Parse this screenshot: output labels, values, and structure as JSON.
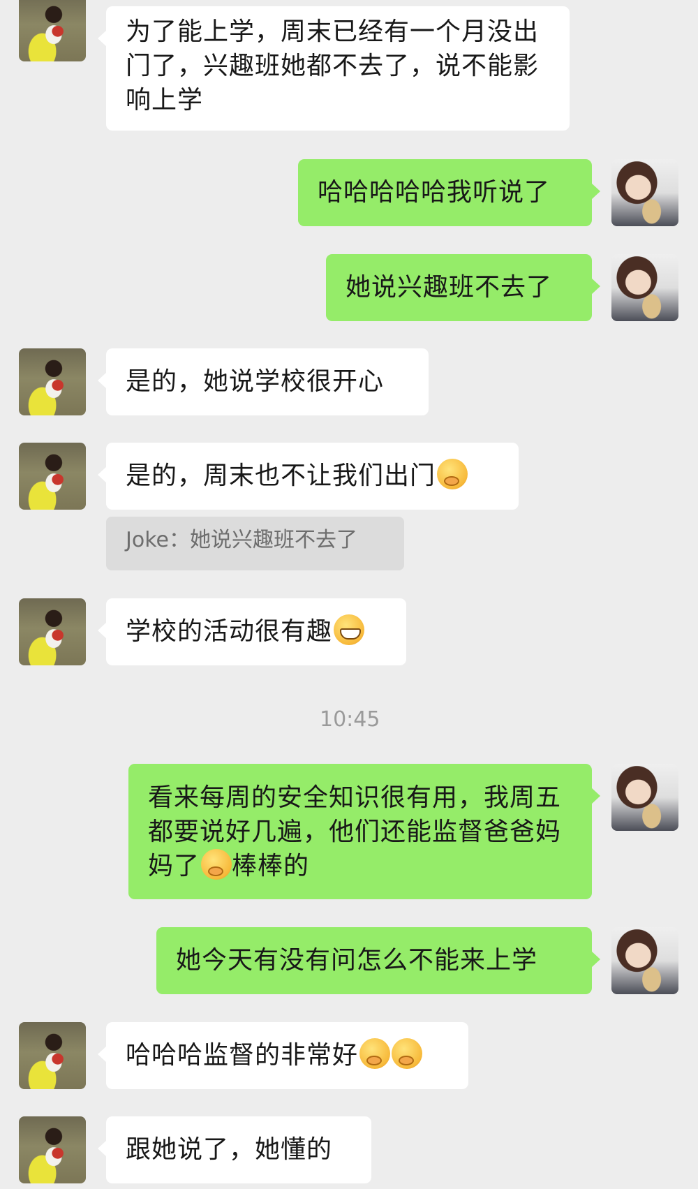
{
  "messages": [
    {
      "side": "left",
      "text": "为了能上学，周末已经有一个月没出门了，兴趣班她都不去了，说不能影响上学",
      "emoji": []
    },
    {
      "side": "right",
      "text": "哈哈哈哈哈我听说了",
      "emoji": []
    },
    {
      "side": "right",
      "text": "她说兴趣班不去了",
      "emoji": []
    },
    {
      "side": "left",
      "text": "是的，她说学校很开心",
      "emoji": []
    },
    {
      "side": "left",
      "text": "是的，周末也不让我们出门",
      "emoji": [
        "thinking-emoji"
      ]
    },
    {
      "side": "left",
      "text": "学校的活动很有趣",
      "emoji": [
        "grinning-emoji"
      ]
    },
    {
      "side": "right",
      "text_before": "看来每周的安全知识很有用，我周五都要说好几遍，他们还能监督爸爸妈妈了",
      "text_after": "棒棒的",
      "emoji": [
        "thinking-emoji"
      ]
    },
    {
      "side": "right",
      "text": "她今天有没有问怎么不能来上学",
      "emoji": []
    },
    {
      "side": "left",
      "text": "哈哈哈监督的非常好",
      "emoji": [
        "thinking-emoji",
        "thinking-emoji"
      ]
    },
    {
      "side": "left",
      "text": "跟她说了，她懂的",
      "emoji": []
    }
  ],
  "quote": {
    "author": "Joke",
    "separator": "：",
    "text": "她说兴趣班不去了"
  },
  "timestamp": "10:45",
  "colors": {
    "background": "#ededed",
    "bubble_self": "#95ec69",
    "bubble_other": "#ffffff",
    "quote_bg": "#dcdcdc"
  }
}
